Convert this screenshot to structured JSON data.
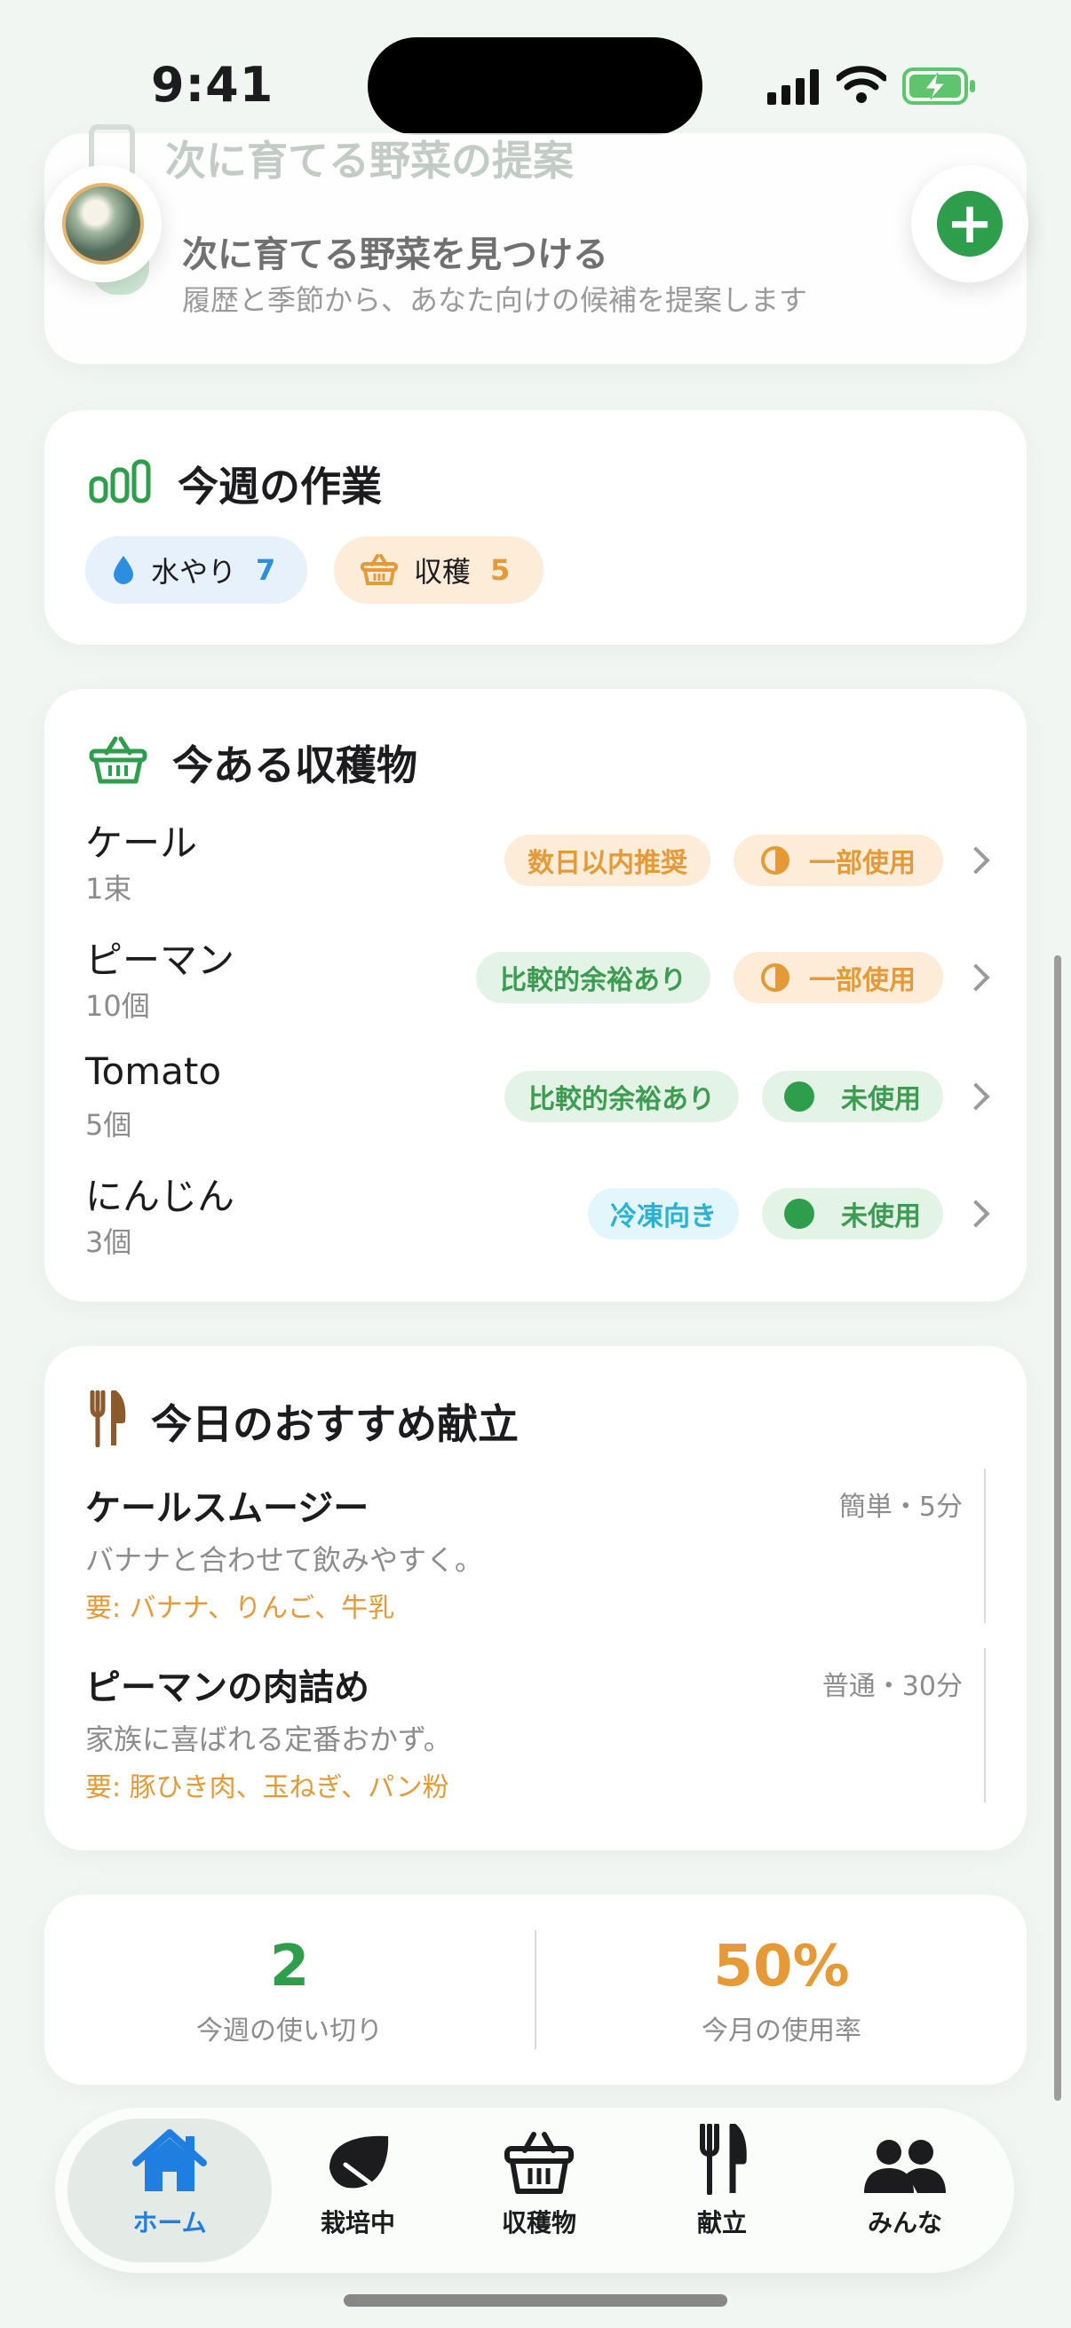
{
  "status": {
    "time": "9:41"
  },
  "suggestion": {
    "section_title": "次に育てる野菜の提案",
    "title": "次に育てる野菜を見つける",
    "subtitle": "履歴と季節から、あなた向けの候補を提案します"
  },
  "tasks": {
    "title": "今週の作業",
    "chips": [
      {
        "label": "水やり",
        "count": "7",
        "icon": "water-drop-icon",
        "color": "#2d8ee0",
        "bg": "#e6f1fc"
      },
      {
        "label": "収穫",
        "count": "5",
        "icon": "basket-icon",
        "color": "#e59a37",
        "bg": "#fcecd8"
      }
    ]
  },
  "harvest": {
    "title": "今ある収穫物",
    "items": [
      {
        "name": "ケール",
        "qty": "1束",
        "freshness": "数日以内推奨",
        "freshness_style": "orange",
        "usage": "一部使用",
        "usage_style": "partial"
      },
      {
        "name": "ピーマン",
        "qty": "10個",
        "freshness": "比較的余裕あり",
        "freshness_style": "green",
        "usage": "一部使用",
        "usage_style": "partial"
      },
      {
        "name": "Tomato",
        "qty": "5個",
        "freshness": "比較的余裕あり",
        "freshness_style": "green",
        "usage": "未使用",
        "usage_style": "unused"
      },
      {
        "name": "にんじん",
        "qty": "3個",
        "freshness": "冷凍向き",
        "freshness_style": "cyan",
        "usage": "未使用",
        "usage_style": "unused"
      }
    ]
  },
  "recipes": {
    "title": "今日のおすすめ献立",
    "items": [
      {
        "name": "ケールスムージー",
        "meta": "簡単・5分",
        "desc": "バナナと合わせて飲みやすく。",
        "req": "要: バナナ、りんご、牛乳"
      },
      {
        "name": "ピーマンの肉詰め",
        "meta": "普通・30分",
        "desc": "家族に喜ばれる定番おかず。",
        "req": "要: 豚ひき肉、玉ねぎ、パン粉"
      }
    ]
  },
  "stats": [
    {
      "value": "2",
      "label": "今週の使い切り",
      "color": "#2e9e4c"
    },
    {
      "value": "50%",
      "label": "今月の使用率",
      "color": "#e59a37"
    }
  ],
  "tabs": [
    {
      "label": "ホーム",
      "icon": "home-icon",
      "active": true
    },
    {
      "label": "栽培中",
      "icon": "leaf-icon",
      "active": false
    },
    {
      "label": "収穫物",
      "icon": "basket-icon",
      "active": false
    },
    {
      "label": "献立",
      "icon": "fork-knife-icon",
      "active": false
    },
    {
      "label": "みんな",
      "icon": "people-icon",
      "active": false
    }
  ]
}
